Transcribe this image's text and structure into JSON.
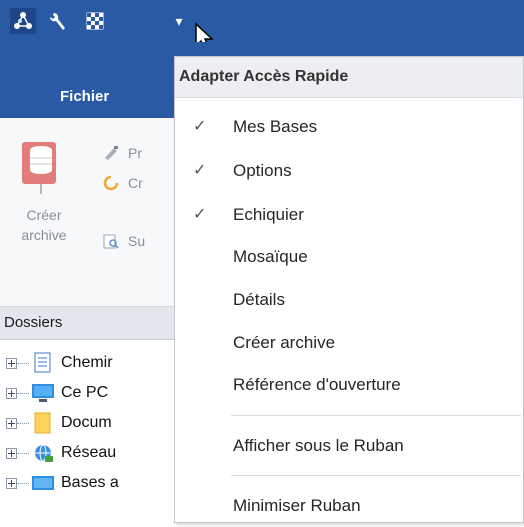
{
  "quick_access": {
    "icons": [
      "network-icon",
      "wrench-icon",
      "chessboard-icon"
    ],
    "dropdown_glyph": "▾"
  },
  "ribbon": {
    "tab_label": "Fichier",
    "create_archive": {
      "line1": "Créer",
      "line2": "archive"
    },
    "small_buttons": [
      "Pr",
      "Cr",
      "Su"
    ]
  },
  "dossiers": {
    "header": "Dossiers",
    "items": [
      "Chemir",
      "Ce PC",
      "Docum",
      "Réseau",
      "Bases a"
    ]
  },
  "menu": {
    "title": "Adapter Accès Rapide",
    "check_glyph": "✓",
    "items": [
      {
        "label": "Mes Bases",
        "checked": true
      },
      {
        "label": "Options",
        "checked": true
      },
      {
        "label": "Echiquier",
        "checked": true
      },
      {
        "label": "Mosaïque",
        "checked": false
      },
      {
        "label": "Détails",
        "checked": false
      },
      {
        "label": "Créer archive",
        "checked": false
      },
      {
        "label": "Référence d'ouverture",
        "checked": false
      },
      {
        "label": "Afficher sous le Ruban",
        "checked": false
      },
      {
        "label": "Minimiser Ruban",
        "checked": false
      }
    ]
  },
  "colors": {
    "titlebar": "#2a5aa4",
    "menu_header_bg": "#eceef1",
    "ribbon_bg": "#f7f8fa"
  }
}
